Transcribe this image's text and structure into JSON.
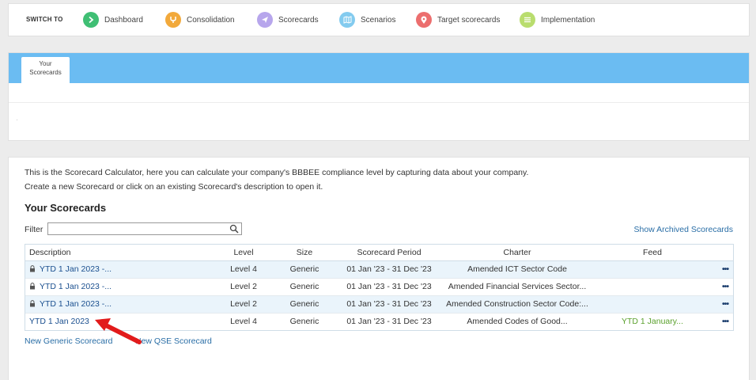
{
  "switch_bar": {
    "label": "SWITCH TO",
    "items": [
      {
        "label": "Dashboard",
        "icon": "chevron-right-icon",
        "color": "#3fbf74"
      },
      {
        "label": "Consolidation",
        "icon": "fork-icon",
        "color": "#f2a93b"
      },
      {
        "label": "Scorecards",
        "icon": "paper-plane-icon",
        "color": "#b7a6ec"
      },
      {
        "label": "Scenarios",
        "icon": "map-icon",
        "color": "#83cbef"
      },
      {
        "label": "Target scorecards",
        "icon": "map-pin-icon",
        "color": "#ec6e6e"
      },
      {
        "label": "Implementation",
        "icon": "list-icon",
        "color": "#b9dd6e"
      }
    ]
  },
  "tabs": [
    {
      "label_line1": "Your",
      "label_line2": "Scorecards"
    }
  ],
  "main": {
    "intro_line1": "This is the Scorecard Calculator, here you can calculate your company's BBBEE compliance level by capturing data about your company.",
    "intro_line2": "Create a new Scorecard or click on an existing Scorecard's description to open it.",
    "heading": "Your Scorecards",
    "filter_label": "Filter",
    "filter_value": "",
    "show_archived": "Show Archived Scorecards",
    "columns": {
      "description": "Description",
      "level": "Level",
      "size": "Size",
      "period": "Scorecard Period",
      "charter": "Charter",
      "feed": "Feed"
    },
    "rows": [
      {
        "locked": true,
        "description": "YTD 1 Jan 2023 -...",
        "level": "Level 4",
        "size": "Generic",
        "period": "01 Jan '23 - 31 Dec '23",
        "charter": "Amended ICT Sector Code",
        "feed": "",
        "menu": "•••"
      },
      {
        "locked": true,
        "description": "YTD 1 Jan 2023 -...",
        "level": "Level 2",
        "size": "Generic",
        "period": "01 Jan '23 - 31 Dec '23",
        "charter": "Amended Financial Services Sector...",
        "feed": "",
        "menu": "•••"
      },
      {
        "locked": true,
        "description": "YTD 1 Jan 2023 -...",
        "level": "Level 2",
        "size": "Generic",
        "period": "01 Jan '23 - 31 Dec '23",
        "charter": "Amended Construction Sector Code:...",
        "feed": "",
        "menu": "•••"
      },
      {
        "locked": false,
        "description": "YTD 1 Jan 2023",
        "level": "Level 4",
        "size": "Generic",
        "period": "01 Jan '23 - 31 Dec '23",
        "charter": "Amended Codes of Good...",
        "feed": "YTD 1 January...",
        "menu": "•••"
      }
    ],
    "new_generic": "New Generic Scorecard",
    "new_qse": "New QSE Scorecard"
  },
  "annotation": {
    "arrow_color": "#e21b1b"
  }
}
